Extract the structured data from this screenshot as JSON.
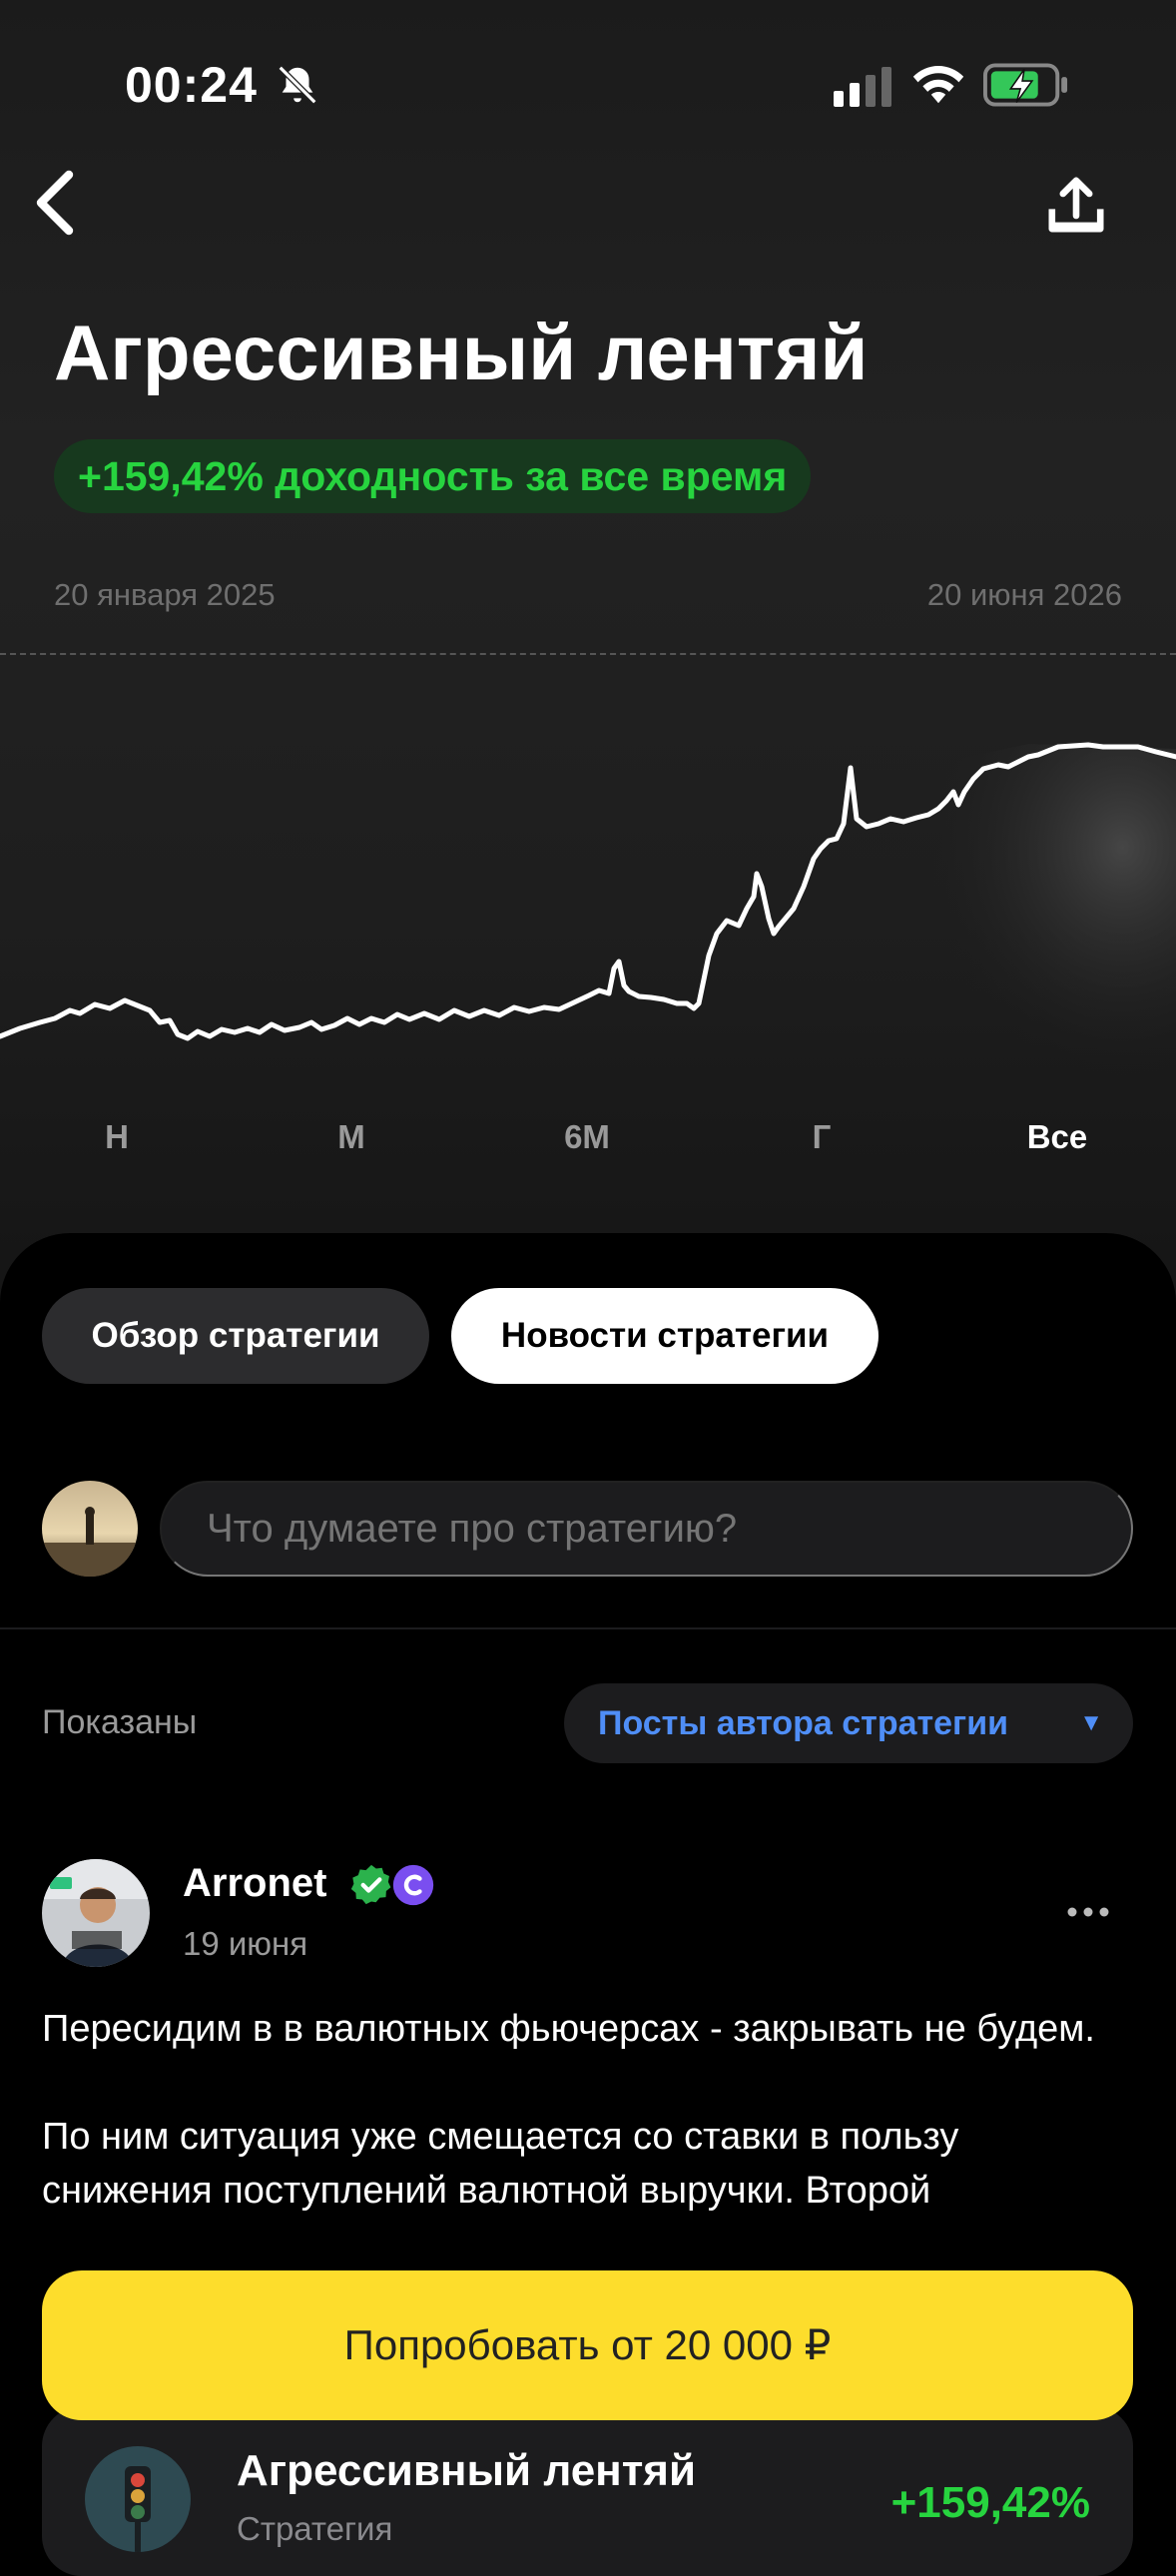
{
  "status_bar": {
    "time": "00:24"
  },
  "header": {
    "title": "Агрессивный лентяй",
    "yield_badge": "+159,42% доходность за все время"
  },
  "chart": {
    "date_start": "20 января 2025",
    "date_end": "20 июня 2026",
    "periods": [
      "Н",
      "М",
      "6М",
      "Г",
      "Все"
    ],
    "active_period": "Все",
    "line_color": "#ffffff"
  },
  "tabs": {
    "overview": "Обзор стратегии",
    "news": "Новости стратегии"
  },
  "comment": {
    "placeholder": "Что думаете про стратегию?"
  },
  "filter": {
    "shown_label": "Показаны",
    "selected": "Посты автора стратегии"
  },
  "post": {
    "author": "Arronet",
    "date": "19 июня",
    "text": "Пересидим в в валютных фьючерсах - закрывать не будем.\n\nПо ним ситуация уже смещается со ставки в пользу снижения поступлений валютной выручки. Второй"
  },
  "cta": {
    "label": "Попробовать от 20 000 ₽"
  },
  "mini_card": {
    "title": "Агрессивный лентяй",
    "subtitle": "Стратегия",
    "value": "+159,42%"
  },
  "colors": {
    "accent_green": "#27d43f",
    "cta_yellow": "#fddd2c",
    "filter_blue": "#4f8ef7"
  }
}
